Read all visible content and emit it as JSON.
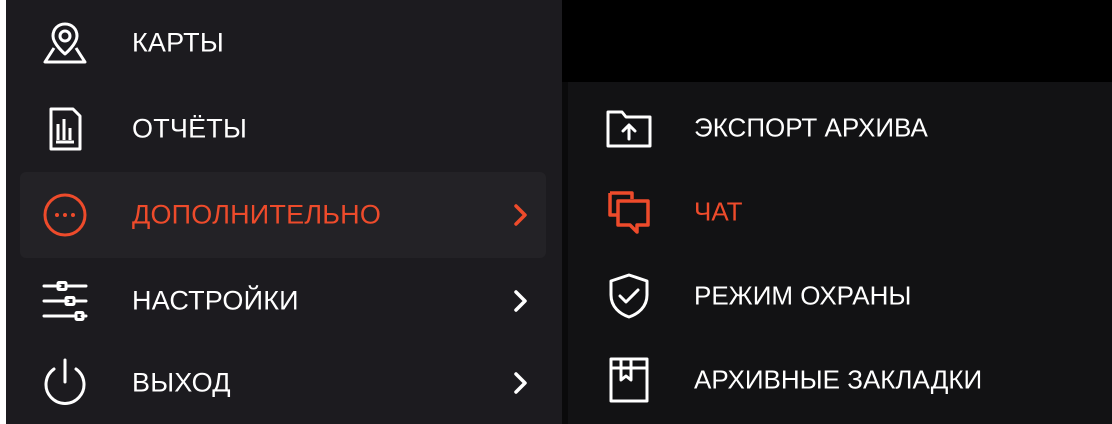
{
  "colors": {
    "accent": "#ee4b2b",
    "text": "#ffffff",
    "menu_bg": "#1c1b1f",
    "submenu_bg": "#121214"
  },
  "main_menu": {
    "items": [
      {
        "label": "КАРТЫ",
        "icon": "map-pin-icon",
        "has_submenu": false,
        "active": false
      },
      {
        "label": "ОТЧЁТЫ",
        "icon": "report-icon",
        "has_submenu": false,
        "active": false
      },
      {
        "label": "ДОПОЛНИТЕЛЬНО",
        "icon": "more-icon",
        "has_submenu": true,
        "active": true
      },
      {
        "label": "НАСТРОЙКИ",
        "icon": "sliders-icon",
        "has_submenu": true,
        "active": false
      },
      {
        "label": "ВЫХОД",
        "icon": "power-icon",
        "has_submenu": true,
        "active": false
      }
    ]
  },
  "submenu": {
    "items": [
      {
        "label": "ЭКСПОРТ АРХИВА",
        "icon": "folder-upload-icon",
        "active": false
      },
      {
        "label": "ЧАТ",
        "icon": "chat-icon",
        "active": true
      },
      {
        "label": "РЕЖИМ ОХРАНЫ",
        "icon": "shield-check-icon",
        "active": false
      },
      {
        "label": "АРХИВНЫЕ ЗАКЛАДКИ",
        "icon": "bookmark-archive-icon",
        "active": false
      }
    ]
  }
}
